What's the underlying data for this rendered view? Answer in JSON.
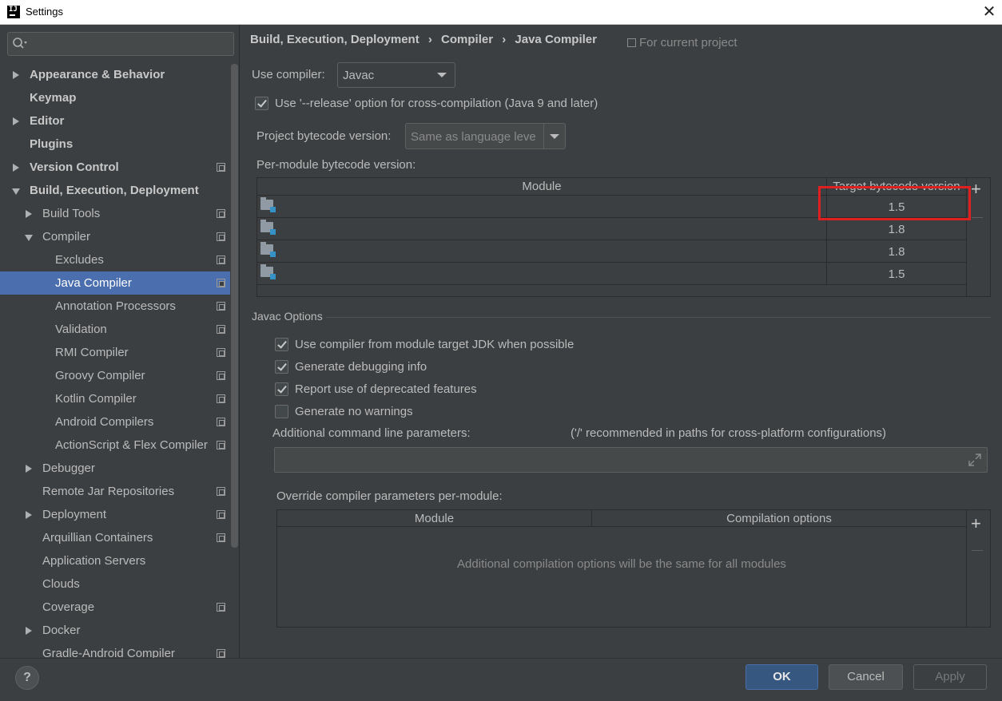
{
  "window": {
    "title": "Settings",
    "app_icon_text": "IJ",
    "close": "✕"
  },
  "sidebar": {
    "search_placeholder": "",
    "items": [
      {
        "label": "Appearance & Behavior",
        "arrow": "right",
        "indent": 0,
        "bold": true,
        "proj": false
      },
      {
        "label": "Keymap",
        "arrow": "none",
        "indent": 0,
        "bold": true,
        "proj": false
      },
      {
        "label": "Editor",
        "arrow": "right",
        "indent": 0,
        "bold": true,
        "proj": false
      },
      {
        "label": "Plugins",
        "arrow": "none",
        "indent": 0,
        "bold": true,
        "proj": false
      },
      {
        "label": "Version Control",
        "arrow": "right",
        "indent": 0,
        "bold": true,
        "proj": true
      },
      {
        "label": "Build, Execution, Deployment",
        "arrow": "down",
        "indent": 0,
        "bold": true,
        "proj": false
      },
      {
        "label": "Build Tools",
        "arrow": "right",
        "indent": 1,
        "bold": false,
        "proj": true
      },
      {
        "label": "Compiler",
        "arrow": "down",
        "indent": 1,
        "bold": false,
        "proj": true
      },
      {
        "label": "Excludes",
        "arrow": "none",
        "indent": 2,
        "bold": false,
        "proj": true
      },
      {
        "label": "Java Compiler",
        "arrow": "none",
        "indent": 2,
        "bold": false,
        "proj": true,
        "selected": true
      },
      {
        "label": "Annotation Processors",
        "arrow": "none",
        "indent": 2,
        "bold": false,
        "proj": true
      },
      {
        "label": "Validation",
        "arrow": "none",
        "indent": 2,
        "bold": false,
        "proj": true
      },
      {
        "label": "RMI Compiler",
        "arrow": "none",
        "indent": 2,
        "bold": false,
        "proj": true
      },
      {
        "label": "Groovy Compiler",
        "arrow": "none",
        "indent": 2,
        "bold": false,
        "proj": true
      },
      {
        "label": "Kotlin Compiler",
        "arrow": "none",
        "indent": 2,
        "bold": false,
        "proj": true
      },
      {
        "label": "Android Compilers",
        "arrow": "none",
        "indent": 2,
        "bold": false,
        "proj": true
      },
      {
        "label": "ActionScript & Flex Compiler",
        "arrow": "none",
        "indent": 2,
        "bold": false,
        "proj": true
      },
      {
        "label": "Debugger",
        "arrow": "right",
        "indent": 1,
        "bold": false,
        "proj": false
      },
      {
        "label": "Remote Jar Repositories",
        "arrow": "none",
        "indent": 1,
        "bold": false,
        "proj": true
      },
      {
        "label": "Deployment",
        "arrow": "right",
        "indent": 1,
        "bold": false,
        "proj": true
      },
      {
        "label": "Arquillian Containers",
        "arrow": "none",
        "indent": 1,
        "bold": false,
        "proj": true
      },
      {
        "label": "Application Servers",
        "arrow": "none",
        "indent": 1,
        "bold": false,
        "proj": false
      },
      {
        "label": "Clouds",
        "arrow": "none",
        "indent": 1,
        "bold": false,
        "proj": false
      },
      {
        "label": "Coverage",
        "arrow": "none",
        "indent": 1,
        "bold": false,
        "proj": true
      },
      {
        "label": "Docker",
        "arrow": "right",
        "indent": 1,
        "bold": false,
        "proj": false
      },
      {
        "label": "Gradle-Android Compiler",
        "arrow": "none",
        "indent": 1,
        "bold": false,
        "proj": true
      }
    ]
  },
  "breadcrumb": [
    "Build, Execution, Deployment",
    "Compiler",
    "Java Compiler"
  ],
  "breadcrumb_sep": "›",
  "for_current_project": "For current project",
  "use_compiler": {
    "label": "Use compiler:",
    "value": "Javac"
  },
  "release_option": {
    "label": "Use '--release' option for cross-compilation (Java 9 and later)",
    "checked": true
  },
  "project_bytecode": {
    "label": "Project bytecode version:",
    "value": "Same as language leve"
  },
  "per_module": {
    "label": "Per-module bytecode version:",
    "columns": [
      "Module",
      "Target bytecode version"
    ],
    "rows": [
      {
        "module": "",
        "version": "1.5"
      },
      {
        "module": "",
        "version": "1.8"
      },
      {
        "module": "",
        "version": "1.8"
      },
      {
        "module": "",
        "version": "1.5"
      }
    ],
    "add": "+",
    "remove": "—"
  },
  "javac_options": {
    "title": "Javac Options",
    "checkboxes": [
      {
        "label": "Use compiler from module target JDK when possible",
        "checked": true
      },
      {
        "label": "Generate debugging info",
        "checked": true
      },
      {
        "label": "Report use of deprecated features",
        "checked": true
      },
      {
        "label": "Generate no warnings",
        "checked": false
      }
    ],
    "cmd_label": "Additional command line parameters:",
    "cmd_hint": "('/' recommended in paths for cross-platform configurations)",
    "cmd_value": ""
  },
  "override": {
    "label": "Override compiler parameters per-module:",
    "columns": [
      "Module",
      "Compilation options"
    ],
    "empty": "Additional compilation options will be the same for all modules",
    "add": "+",
    "remove": "—"
  },
  "footer": {
    "help": "?",
    "ok": "OK",
    "cancel": "Cancel",
    "apply": "Apply"
  },
  "colors": {
    "selection": "#4b6eaf",
    "highlight_box": "#e02020",
    "ok_button": "#365880"
  }
}
